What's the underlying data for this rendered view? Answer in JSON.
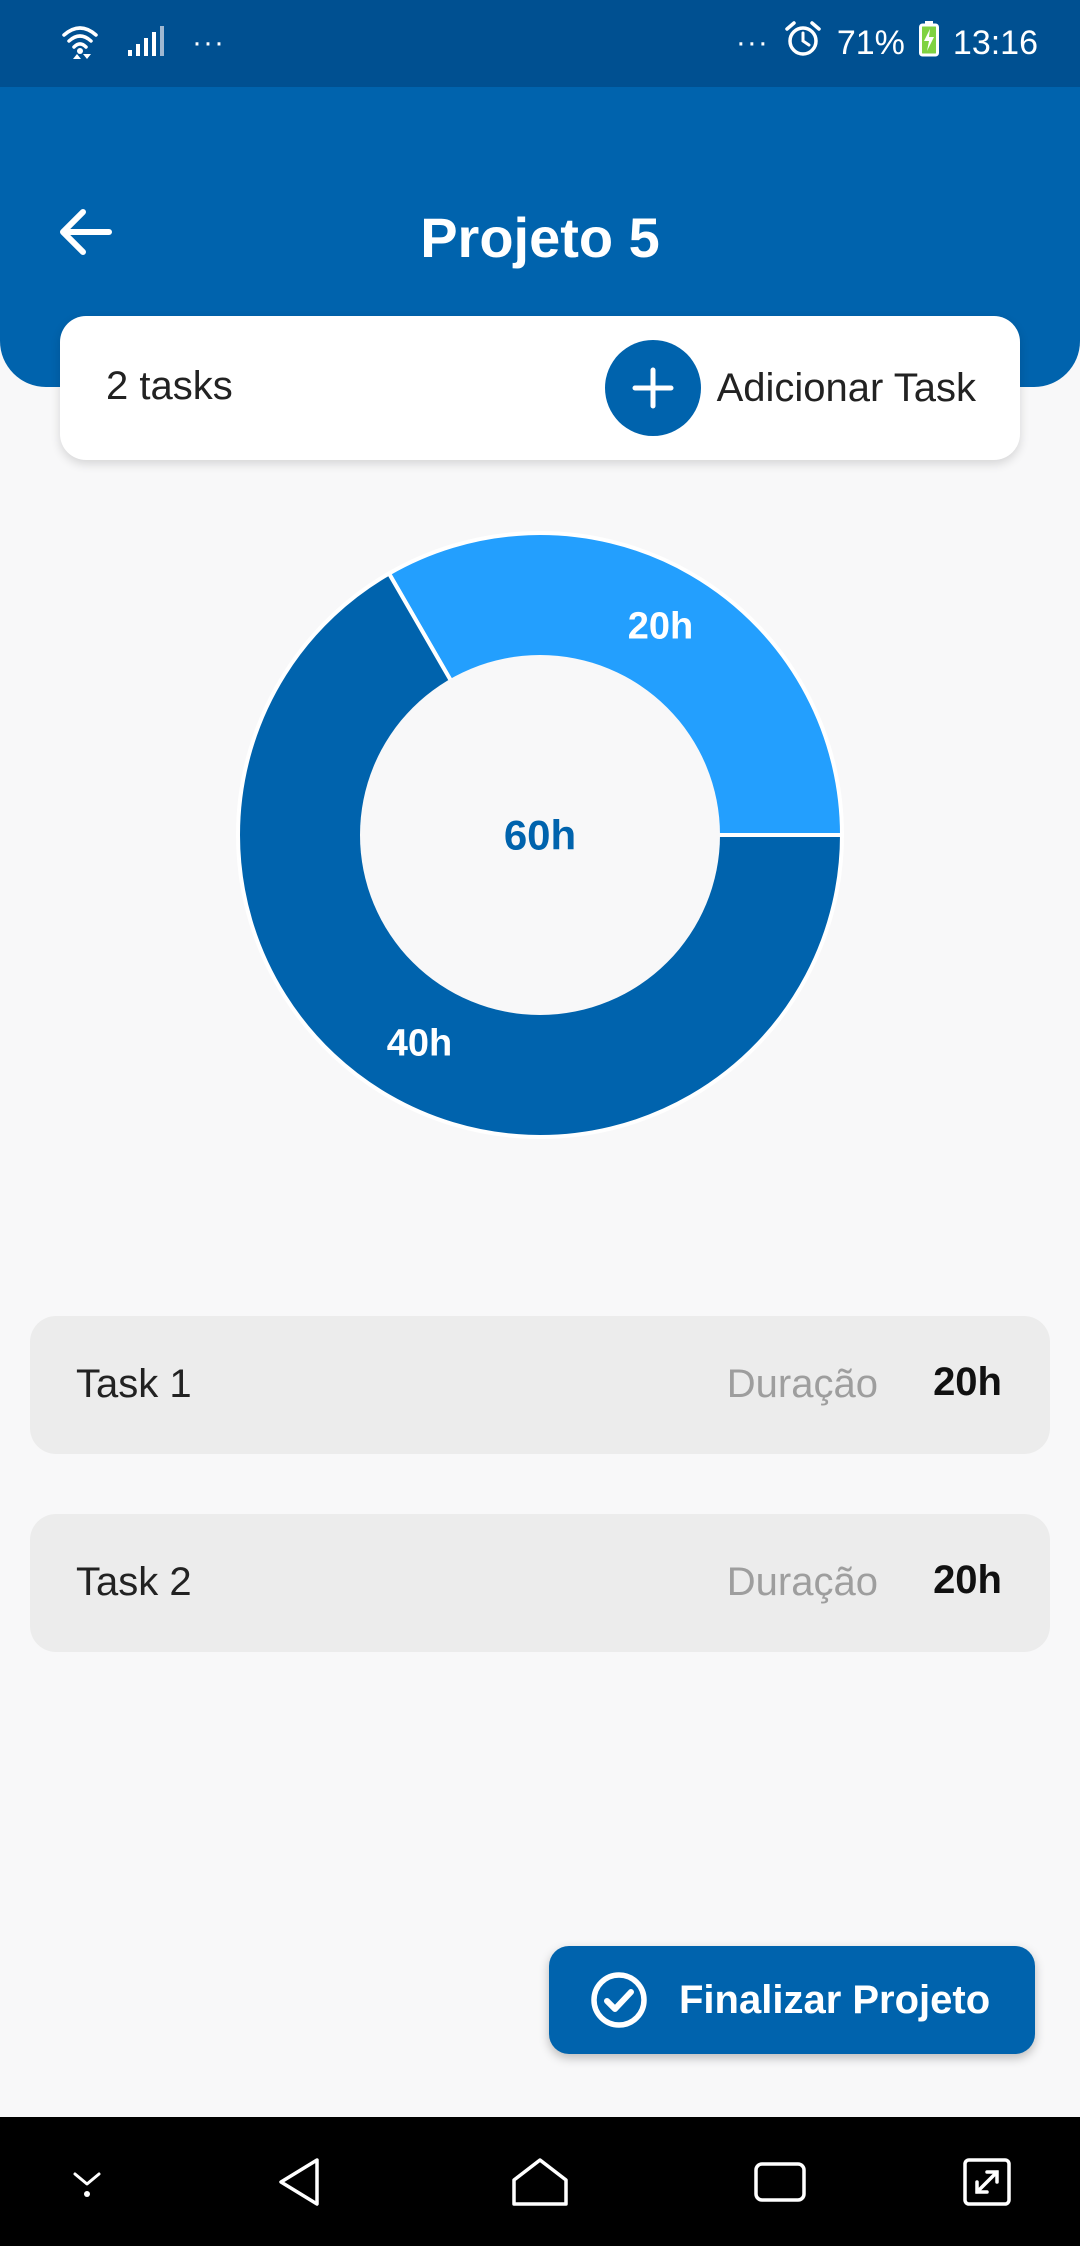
{
  "status_bar": {
    "left_dots": "···",
    "right_dots": "···",
    "battery": "71%",
    "time": "13:16"
  },
  "header": {
    "title": "Projeto 5"
  },
  "summary": {
    "task_count": "2 tasks",
    "add_label": "Adicionar Task"
  },
  "chart_data": {
    "type": "pie",
    "center_label": "60h",
    "slices": [
      {
        "label": "20h",
        "value": 20,
        "color": "#239ffe"
      },
      {
        "label": "40h",
        "value": 40,
        "color": "#0063ad"
      }
    ]
  },
  "tasks": [
    {
      "name": "Task 1",
      "duration_label": "Duração",
      "duration": "20h"
    },
    {
      "name": "Task 2",
      "duration_label": "Duração",
      "duration": "20h"
    }
  ],
  "finish": {
    "label": "Finalizar Projeto"
  },
  "colors": {
    "primary": "#0063ad",
    "primary_dark": "#005091",
    "accent": "#239ffe"
  }
}
